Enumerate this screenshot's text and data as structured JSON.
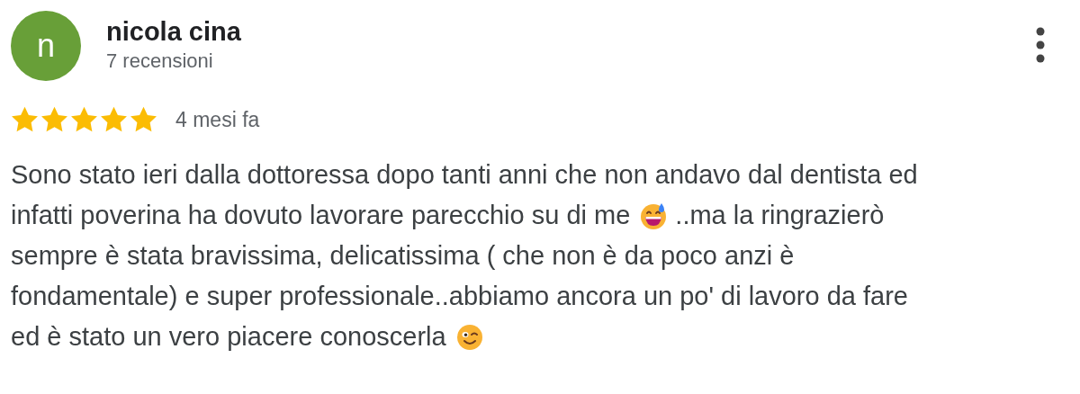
{
  "review": {
    "avatar_letter": "n",
    "author": "nicola cina",
    "review_count": "7 recensioni",
    "stars": 5,
    "time": "4 mesi fa",
    "lines": [
      [
        {
          "kind": "text",
          "text": "Sono stato ieri dalla dottoressa dopo tanti anni che non andavo dal dentista ed"
        }
      ],
      [
        {
          "kind": "text",
          "text": "infatti poverina ha dovuto lavorare parecchio su di me"
        },
        {
          "kind": "sweat-emoji"
        },
        {
          "kind": "text",
          "text": "..ma la ringrazierò"
        }
      ],
      [
        {
          "kind": "text",
          "text": "sempre è stata bravissima, delicatissima ( che non è da poco anzi è"
        }
      ],
      [
        {
          "kind": "text",
          "text": "fondamentale) e super professionale..abbiamo ancora un po' di lavoro da fare"
        }
      ],
      [
        {
          "kind": "text",
          "text": "ed è stato un vero piacere conoscerla"
        },
        {
          "kind": "wink-emoji"
        }
      ]
    ]
  }
}
